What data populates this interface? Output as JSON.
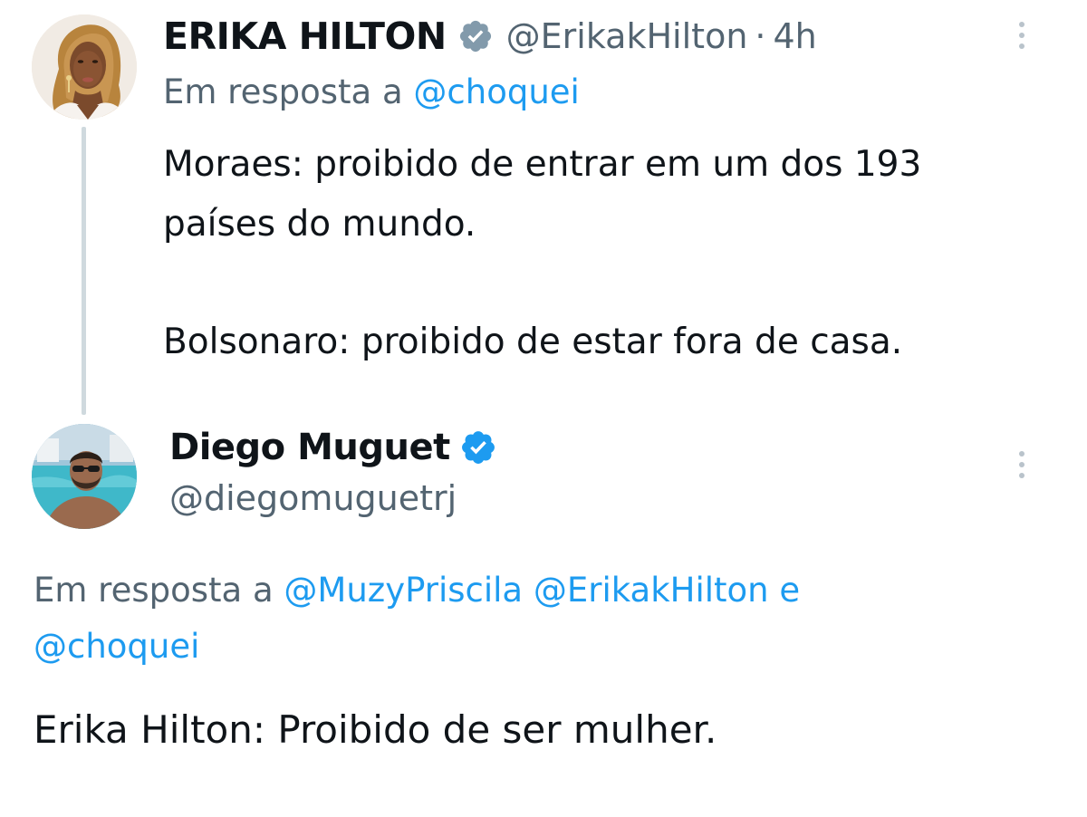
{
  "tweet1": {
    "author_name": "ERIKA HILTON",
    "author_handle": "@ErikakHilton",
    "separator": "·",
    "time": "4h",
    "verified_badge": "gray-verified-badge-icon",
    "reply_prefix": "Em resposta a",
    "reply_to": "@choquei",
    "text_line1": "Moraes: proibido de entrar em um dos 193",
    "text_line2": "países do mundo.",
    "text_line3": "Bolsonaro: proibido de estar fora de casa."
  },
  "tweet2": {
    "author_name": "Diego Muguet",
    "author_handle": "@diegomuguetrj",
    "verified_badge": "blue-verified-badge-icon",
    "reply_prefix": "Em resposta a",
    "reply_to_1": "@MuzyPriscila",
    "reply_to_2": "@ErikakHilton",
    "reply_conjunction": "e",
    "reply_to_3": "@choquei",
    "text": "Erika Hilton: Proibido de ser mulher."
  },
  "colors": {
    "text_primary": "#0f1419",
    "text_secondary": "#536471",
    "link": "#1d9bf0",
    "thread_line": "#cfd9de",
    "verified_blue": "#1d9bf0",
    "verified_gray": "#829aab"
  },
  "icons": {
    "more_menu": "more-vertical-icon"
  }
}
